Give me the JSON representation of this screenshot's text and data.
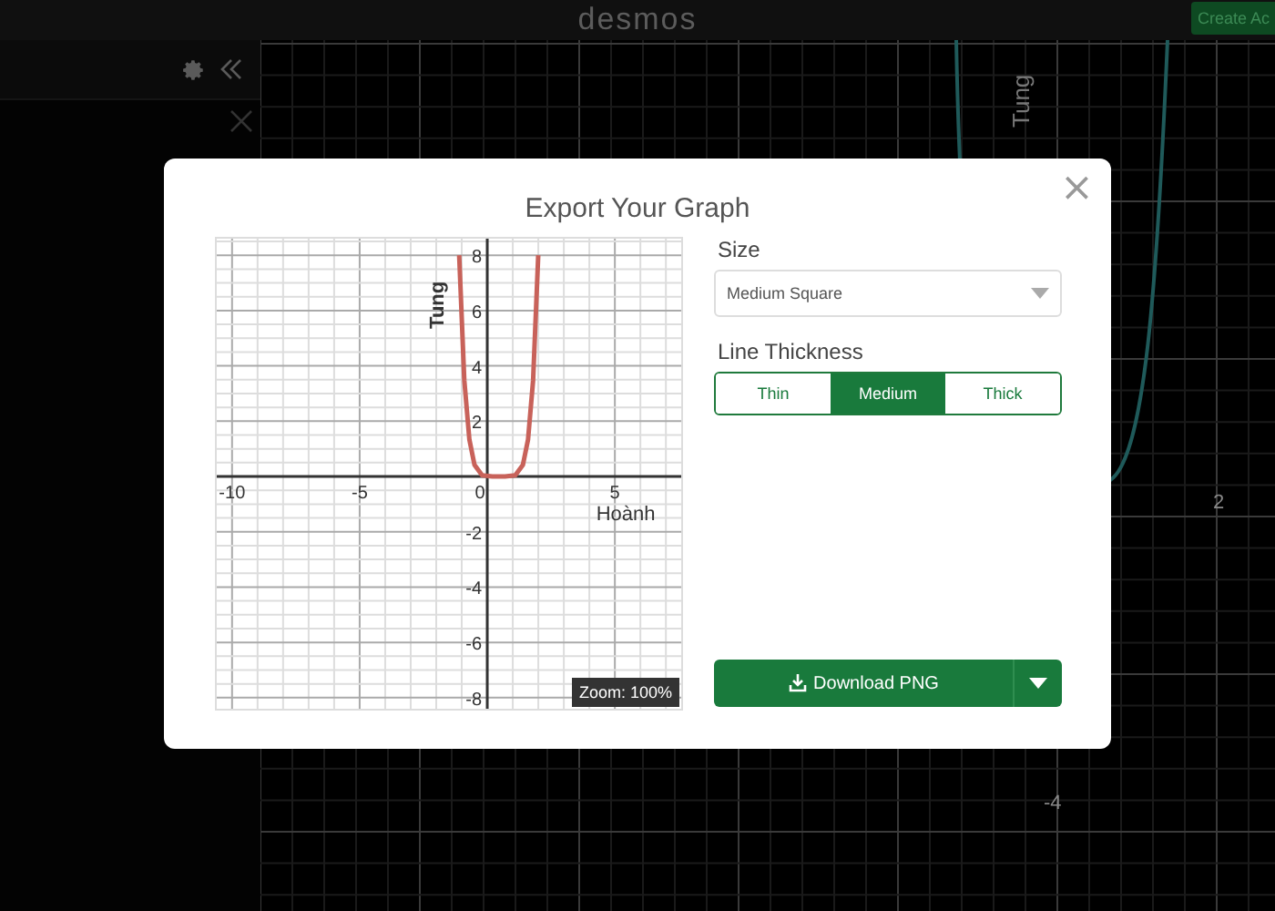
{
  "topbar": {
    "logo": "desmos",
    "account_button": "Create Ac"
  },
  "background_graph": {
    "labels": [
      {
        "kind": "axis-title",
        "text": "Tung"
      },
      {
        "kind": "x-tick",
        "text": "2"
      },
      {
        "kind": "y-tick",
        "text": "-4"
      }
    ]
  },
  "dialog": {
    "title": "Export Your Graph",
    "close": "×",
    "preview": {
      "zoom_badge": "Zoom: 100%",
      "chart_data": {
        "type": "line",
        "xlabel": "Hoành",
        "ylabel": "Tung",
        "x": [
          -1.1,
          -0.9,
          -0.7,
          -0.5,
          -0.2,
          0.2,
          0.45,
          0.7,
          1.1,
          1.4,
          1.6,
          1.8,
          2.0
        ],
        "series": [
          {
            "color": "#c8625a",
            "values": [
              8,
              3.49,
              1.33,
              0.42,
              0.04,
              0,
              0,
              0,
              0.04,
              0.42,
              1.33,
              3.49,
              8
            ]
          }
        ],
        "xlim": [
          -10.6,
          7.6
        ],
        "ylim": [
          -8.4,
          8.6
        ],
        "xticks": [
          -10,
          -5,
          0,
          5
        ],
        "yticks": [
          -8,
          -6,
          -4,
          -2,
          2,
          4,
          6,
          8
        ],
        "grid": true
      }
    },
    "size": {
      "label": "Size",
      "value": "Medium Square"
    },
    "line_thickness": {
      "label": "Line Thickness",
      "options": [
        {
          "label": "Thin",
          "selected": false
        },
        {
          "label": "Medium",
          "selected": true
        },
        {
          "label": "Thick",
          "selected": false
        }
      ]
    },
    "download": {
      "label": "Download PNG"
    }
  }
}
